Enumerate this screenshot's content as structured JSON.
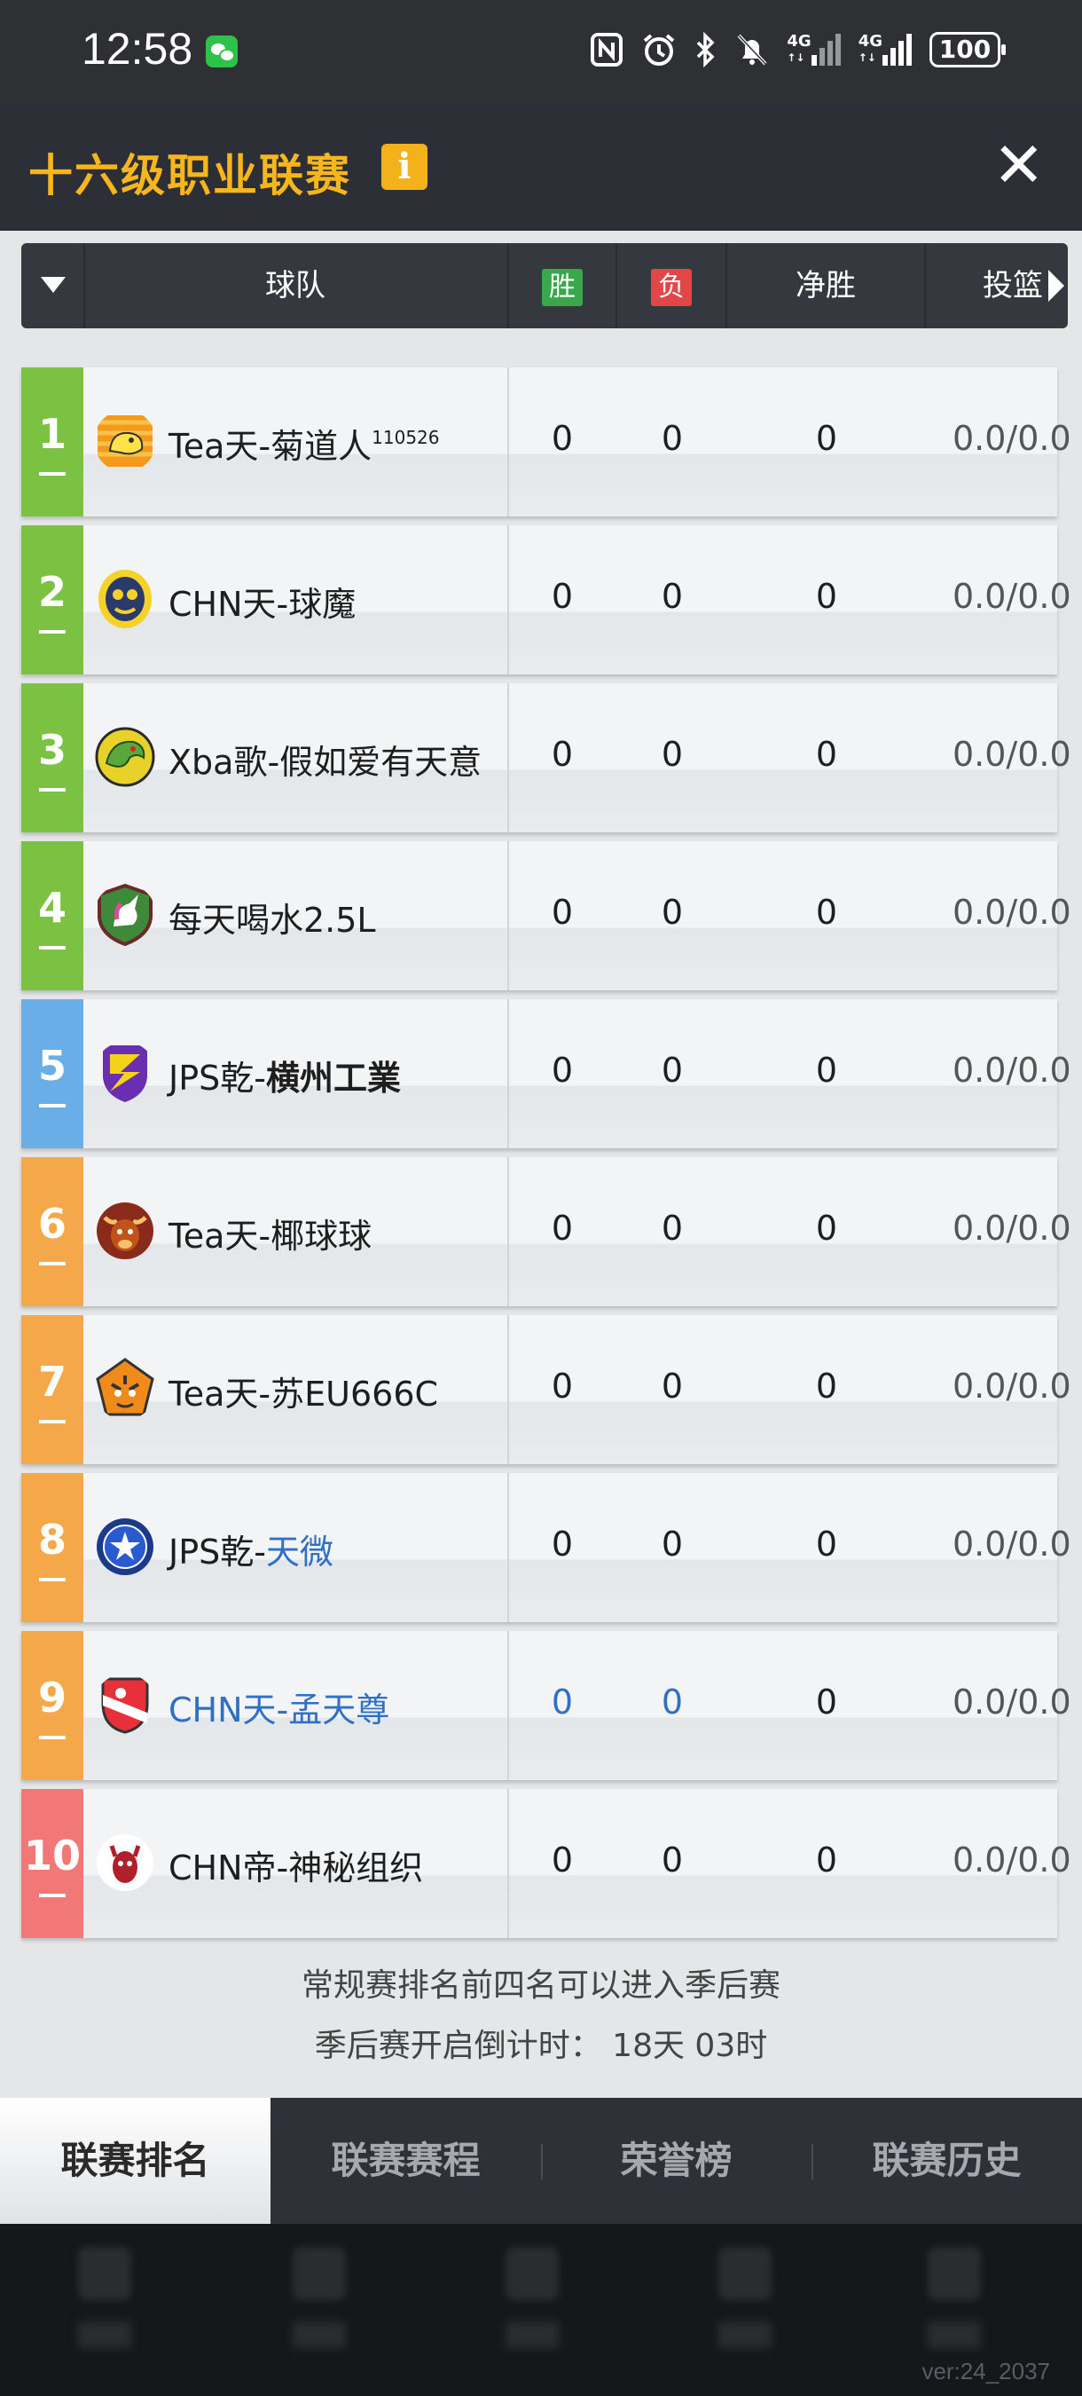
{
  "status_bar": {
    "time": "12:58",
    "network_1": "4G",
    "network_2": "4G",
    "battery": "100"
  },
  "header": {
    "title": "十六级职业联赛",
    "info_label": "i",
    "close_label": "✕"
  },
  "table": {
    "columns": {
      "team": "球队",
      "win": "胜",
      "loss": "负",
      "net": "净胜",
      "shooting": "投篮"
    },
    "rows": [
      {
        "rank": "1",
        "name": "Tea天-菊道人",
        "name_prefix": "Tea天-",
        "name_suffix": "菊道人",
        "sup": "110526",
        "win": "0",
        "loss": "0",
        "net": "0",
        "ratio": "0.0/0.0",
        "rank_color": "#7cc242",
        "logo_icon": "yellow-dog-icon"
      },
      {
        "rank": "2",
        "name": "CHN天-球魔",
        "name_prefix": "CHN天-",
        "name_suffix": "球魔",
        "sup": "",
        "win": "0",
        "loss": "0",
        "net": "0",
        "ratio": "0.0/0.0",
        "rank_color": "#7cc242",
        "logo_icon": "yellow-mask-icon"
      },
      {
        "rank": "3",
        "name": "Xba歌-假如爱有天意",
        "name_prefix": "Xba歌-",
        "name_suffix": "假如爱有天意",
        "sup": "",
        "win": "0",
        "loss": "0",
        "net": "0",
        "ratio": "0.0/0.0",
        "rank_color": "#7cc242",
        "logo_icon": "green-dragon-icon"
      },
      {
        "rank": "4",
        "name": "每天喝水2.5L",
        "name_prefix": "",
        "name_suffix": "每天喝水2.5L",
        "sup": "",
        "win": "0",
        "loss": "0",
        "net": "0",
        "ratio": "0.0/0.0",
        "rank_color": "#7cc242",
        "logo_icon": "unicorn-shield-icon"
      },
      {
        "rank": "5",
        "name": "JPS乾-横州工業",
        "name_prefix": "JPS乾-",
        "name_suffix": "横州工業",
        "sup": "",
        "win": "0",
        "loss": "0",
        "net": "0",
        "ratio": "0.0/0.0",
        "rank_color": "#6aaee8",
        "logo_icon": "purple-crest-icon"
      },
      {
        "rank": "6",
        "name": "Tea天-椰球球",
        "name_prefix": "Tea天-",
        "name_suffix": "椰球球",
        "sup": "",
        "win": "0",
        "loss": "0",
        "net": "0",
        "ratio": "0.0/0.0",
        "rank_color": "#f5a84a",
        "logo_icon": "bull-icon"
      },
      {
        "rank": "7",
        "name": "Tea天-苏EU666C",
        "name_prefix": "Tea天-",
        "name_suffix": "苏EU666C",
        "sup": "",
        "win": "0",
        "loss": "0",
        "net": "0",
        "ratio": "0.0/0.0",
        "rank_color": "#f5a84a",
        "logo_icon": "tiger-icon"
      },
      {
        "rank": "8",
        "name": "JPS乾-天微",
        "name_prefix": "JPS乾-",
        "name_suffix": "天微",
        "sup": "",
        "win": "0",
        "loss": "0",
        "net": "0",
        "ratio": "0.0/0.0",
        "rank_color": "#f5a84a",
        "logo_icon": "blue-star-shield-icon"
      },
      {
        "rank": "9",
        "name": "CHN天-孟天尊",
        "name_prefix": "CHN天-",
        "name_suffix": "孟天尊",
        "sup": "",
        "win": "0",
        "loss": "0",
        "net": "0",
        "ratio": "0.0/0.0",
        "rank_color": "#f5a84a",
        "logo_icon": "red-pennant-icon"
      },
      {
        "rank": "10",
        "name": "CHN帝-神秘组织",
        "name_prefix": "CHN帝-",
        "name_suffix": "神秘组织",
        "sup": "",
        "win": "0",
        "loss": "0",
        "net": "0",
        "ratio": "0.0/0.0",
        "rank_color": "#f27777",
        "logo_icon": "devil-icon"
      }
    ]
  },
  "notes": {
    "line1": "常规赛排名前四名可以进入季后赛",
    "line2": "季后赛开启倒计时：  18天 03时"
  },
  "tabs": [
    {
      "label": "联赛排名",
      "active": true
    },
    {
      "label": "联赛赛程",
      "active": false
    },
    {
      "label": "荣誉榜",
      "active": false
    },
    {
      "label": "联赛历史",
      "active": false
    }
  ],
  "footer": {
    "version": "ver:24_2037"
  }
}
